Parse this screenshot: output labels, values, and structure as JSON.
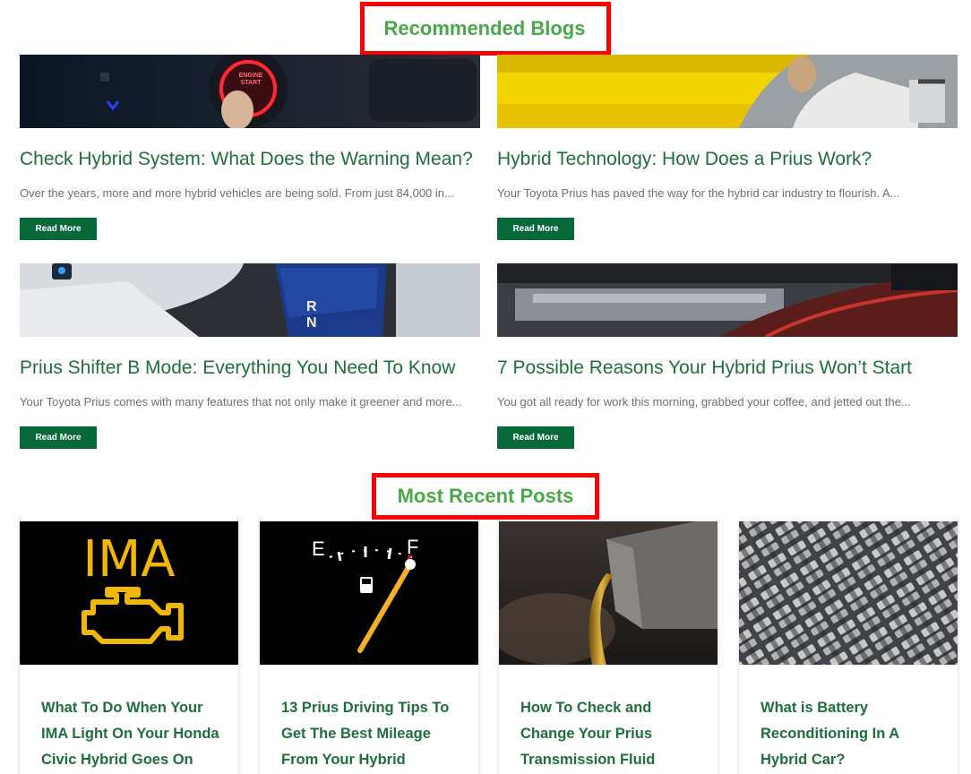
{
  "recommended": {
    "title": "Recommended Blogs",
    "read_more_label": "Read More",
    "posts": [
      {
        "title": "Check Hybrid System: What Does the Warning Mean?",
        "excerpt": "Over the years, more and more hybrid vehicles are being sold. From just 84,000 in..."
      },
      {
        "title": "Hybrid Technology: How Does a Prius Work?",
        "excerpt": "Your Toyota Prius has paved the way for the hybrid car industry to flourish. A..."
      },
      {
        "title": "Prius Shifter B Mode: Everything You Need To Know",
        "excerpt": "Your Toyota Prius comes with many features that not only make it greener and more..."
      },
      {
        "title": "7 Possible Reasons Your Hybrid Prius Won’t Start",
        "excerpt": "You got all ready for work this morning, grabbed your coffee, and jetted out the..."
      }
    ]
  },
  "recent": {
    "title": "Most Recent Posts",
    "posts": [
      {
        "title": "What To Do When Your IMA Light On Your Honda Civic Hybrid Goes On",
        "image_text": "IMA"
      },
      {
        "title": "13 Prius Driving Tips To Get The Best Mileage From Your Hybrid",
        "gauge_e": "E",
        "gauge_f": "F"
      },
      {
        "title": "How To Check and Change Your Prius Transmission Fluid"
      },
      {
        "title": "What is Battery Reconditioning In A Hybrid Car?"
      }
    ]
  },
  "image_text": {
    "engine_button": "ENGINE START",
    "shifter_letters": "R N"
  },
  "colors": {
    "accent_green": "#4aa84a",
    "title_green": "#1f6e3c",
    "button_green": "#07683a",
    "highlight_red": "#ff0000"
  }
}
